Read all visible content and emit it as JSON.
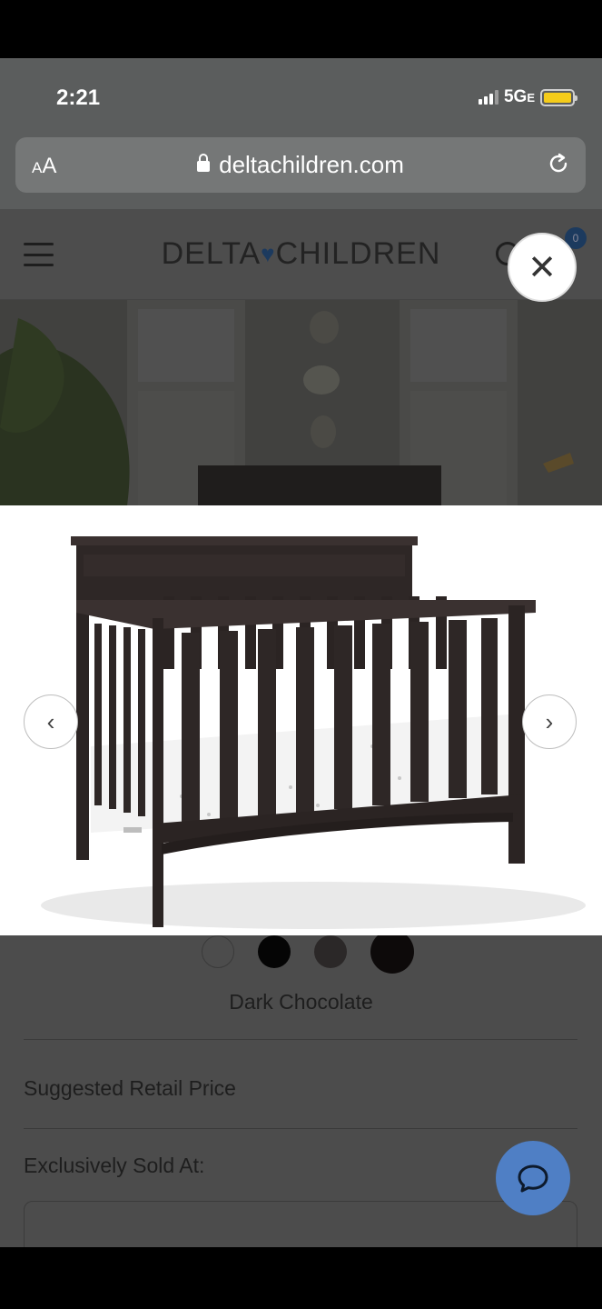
{
  "status_bar": {
    "time": "2:21",
    "network": "5G",
    "network_suffix": "E"
  },
  "browser": {
    "text_size_label": "AA",
    "url": "deltachildren.com"
  },
  "site": {
    "logo_left": "DELTA",
    "logo_heart": "♥",
    "logo_right": "CHILDREN",
    "cart_count": "0"
  },
  "gallery": {
    "prev_icon": "chevron-left",
    "next_icon": "chevron-right",
    "close_icon": "close"
  },
  "product": {
    "swatches": [
      {
        "name": "white",
        "color": "#4c4c4c"
      },
      {
        "name": "black",
        "color": "#050505"
      },
      {
        "name": "gray",
        "color": "#2b2828"
      },
      {
        "name": "dark-chocolate",
        "color": "#0d0a0a"
      }
    ],
    "color_name": "Dark Chocolate",
    "suggested_price_label": "Suggested Retail Price",
    "sold_at_label": "Exclusively Sold At:"
  },
  "colors": {
    "chat_accent": "#4f7fc5",
    "brand_navy": "#1c3a5e",
    "crib_wood": "#2e2726"
  }
}
